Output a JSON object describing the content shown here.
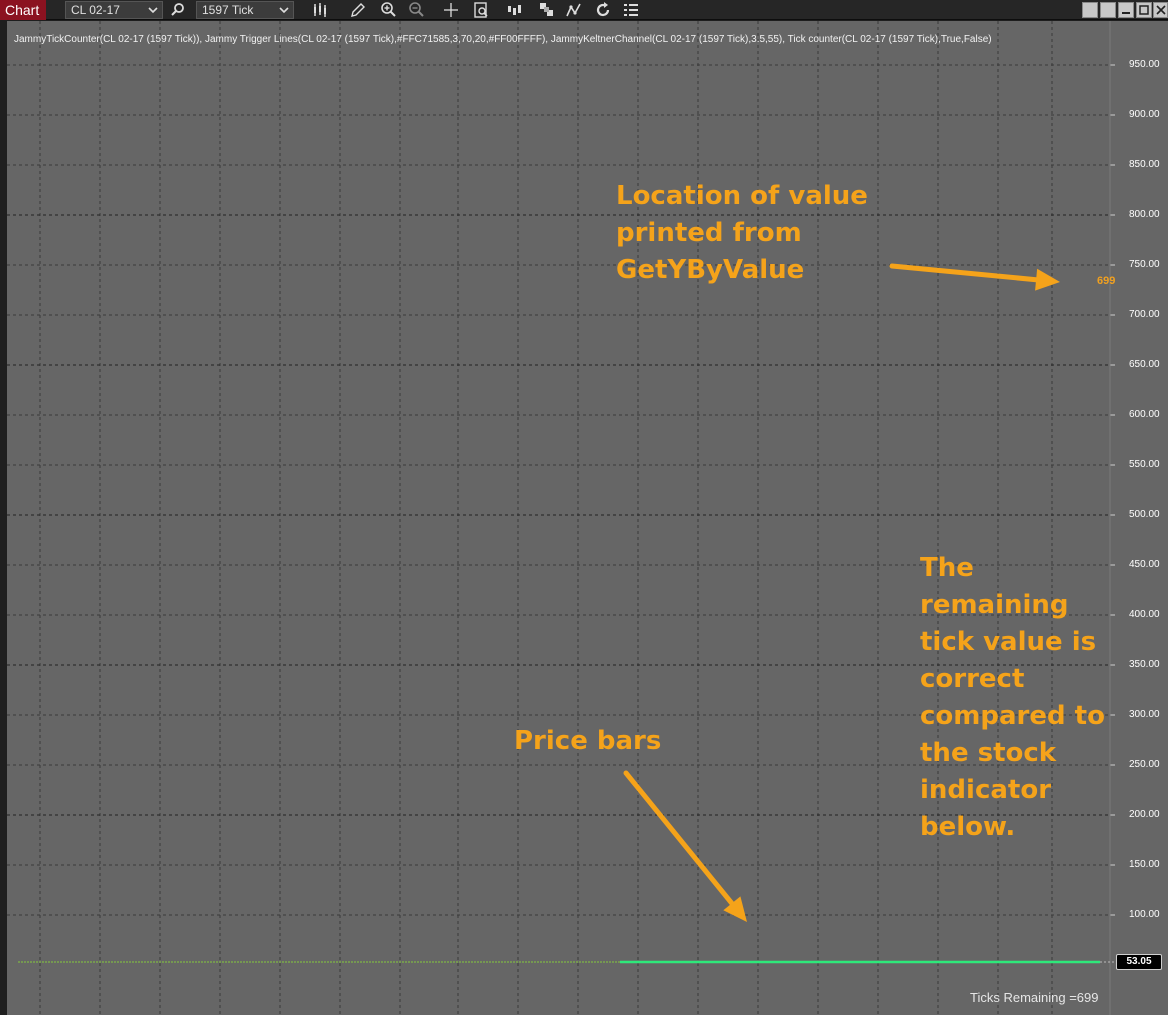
{
  "toolbar": {
    "tab_label": "Chart",
    "instrument": "CL 02-17",
    "interval": "1597 Tick",
    "icons": [
      "search-icon",
      "bar-type-icon",
      "pencil-icon",
      "zoom-in-icon",
      "zoom-out-icon",
      "crosshair-icon",
      "data-box-icon",
      "bar-spacing-icon",
      "strategy-icon",
      "indicator-icon",
      "reload-icon",
      "properties-icon"
    ],
    "window_buttons": [
      "restore-icon",
      "tile-icon",
      "minimize-icon",
      "maximize-icon",
      "close-icon"
    ]
  },
  "chart": {
    "background": "#666666",
    "indicator_labels": "JammyTickCounter(CL 02-17 (1597 Tick)),  Jammy Trigger Lines(CL 02-17 (1597 Tick),#FFC71585,3,70,20,#FF00FFFF),  JammyKeltnerChannel(CL 02-17 (1597 Tick),3.5,55), Tick counter(CL 02-17 (1597 Tick),True,False)",
    "price_axis_ticks": [
      "950.00",
      "900.00",
      "850.00",
      "800.00",
      "750.00",
      "700.00",
      "650.00",
      "600.00",
      "550.00",
      "500.00",
      "450.00",
      "400.00",
      "350.00",
      "300.00",
      "250.00",
      "200.00",
      "150.00",
      "100.00"
    ],
    "current_price": "53.05",
    "printed_value": "699",
    "ticks_remaining": "Ticks Remaining =699",
    "price_line_color": "#2ee87a",
    "annotation_color": "#f5a31a"
  },
  "annotations": {
    "location_lines": [
      "Location of value",
      "printed from",
      "GetYByValue"
    ],
    "price_bars": "Price bars",
    "remaining_lines": [
      "The",
      "remaining",
      "tick value is",
      "correct",
      "compared to",
      "the stock",
      "indicator",
      "below."
    ]
  }
}
